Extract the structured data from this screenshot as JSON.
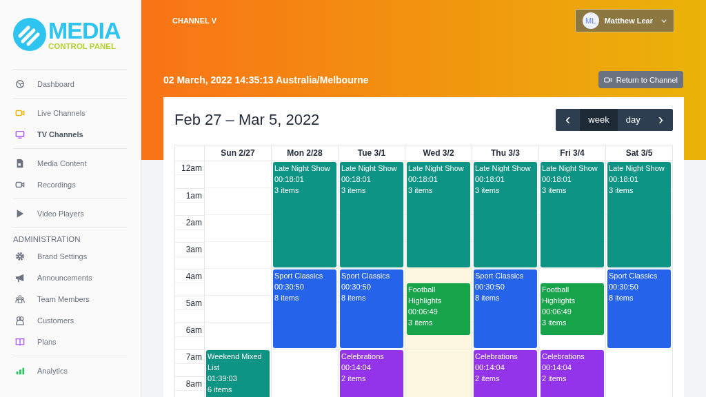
{
  "logo": {
    "title": "MEDIA",
    "subtitle": "CONTROL PANEL"
  },
  "sidebar": {
    "groups": [
      {
        "items": [
          {
            "label": "Dashboard",
            "kind": "dashboard",
            "selected": false
          }
        ]
      },
      {
        "items": [
          {
            "label": "Live Channels",
            "kind": "live",
            "selected": false
          },
          {
            "label": "TV Channels",
            "kind": "tv",
            "selected": true
          }
        ]
      },
      {
        "items": [
          {
            "label": "Media Content",
            "kind": "file",
            "selected": false
          },
          {
            "label": "Recordings",
            "kind": "camera",
            "selected": false
          }
        ]
      },
      {
        "items": [
          {
            "label": "Video Players",
            "kind": "play",
            "selected": false
          }
        ]
      },
      {
        "heading": "ADMINISTRATION",
        "items": [
          {
            "label": "Brand Settings",
            "kind": "gear",
            "selected": false
          },
          {
            "label": "Announcements",
            "kind": "megaphone",
            "selected": false
          },
          {
            "label": "Team Members",
            "kind": "team",
            "selected": false
          },
          {
            "label": "Customers",
            "kind": "users",
            "selected": false
          },
          {
            "label": "Plans",
            "kind": "book",
            "selected": false
          }
        ]
      },
      {
        "items": [
          {
            "label": "Analytics",
            "kind": "chart",
            "selected": false
          }
        ]
      }
    ]
  },
  "header": {
    "channel": "CHANNEL V",
    "user": {
      "initials": "ML",
      "name": "Matthew Lear"
    }
  },
  "datetime": "02 March, 2022 14:35:13 Australia/Melbourne",
  "return_button": "Return to Channel",
  "calendar": {
    "title": "Feb 27 – Mar 5, 2022",
    "toolbar": {
      "prev": "‹",
      "next": "›",
      "views": [
        {
          "label": "week",
          "selected": true
        },
        {
          "label": "day",
          "selected": false
        }
      ]
    },
    "times": [
      "12am",
      "1am",
      "2am",
      "3am",
      "4am",
      "5am",
      "6am",
      "7am",
      "8am"
    ],
    "days": [
      {
        "label": "Sun 2/27",
        "today": false,
        "events": [
          {
            "title": "Weekend Mixed List",
            "duration": "01:39:03",
            "count": "6 items",
            "kind": "day",
            "color": "#0e9484"
          }
        ]
      },
      {
        "label": "Mon 2/28",
        "today": false,
        "events": [
          {
            "title": "Late Night Show",
            "duration": "00:18:01",
            "count": "3 items",
            "kind": "night",
            "color": "#0e9484"
          },
          {
            "title": "Sport Classics",
            "duration": "00:30:50",
            "count": "8 items",
            "kind": "early",
            "color": "#2563eb"
          }
        ]
      },
      {
        "label": "Tue 3/1",
        "today": false,
        "events": [
          {
            "title": "Late Night Show",
            "duration": "00:18:01",
            "count": "3 items",
            "kind": "night",
            "color": "#0e9484"
          },
          {
            "title": "Sport Classics",
            "duration": "00:30:50",
            "count": "8 items",
            "kind": "early",
            "color": "#2563eb"
          },
          {
            "title": "Celebrations",
            "duration": "00:14:04",
            "count": "2 items",
            "kind": "day",
            "color": "#9333ea"
          }
        ]
      },
      {
        "label": "Wed 3/2",
        "today": true,
        "events": [
          {
            "title": "Late Night Show",
            "duration": "00:18:01",
            "count": "3 items",
            "kind": "night",
            "color": "#0e9484"
          },
          {
            "title": "Football Highlights",
            "duration": "00:06:49",
            "count": "3 items",
            "kind": "dawn",
            "color": "#16a34a"
          }
        ]
      },
      {
        "label": "Thu 3/3",
        "today": false,
        "events": [
          {
            "title": "Late Night Show",
            "duration": "00:18:01",
            "count": "3 items",
            "kind": "night",
            "color": "#0e9484"
          },
          {
            "title": "Sport Classics",
            "duration": "00:30:50",
            "count": "8 items",
            "kind": "early",
            "color": "#2563eb"
          },
          {
            "title": "Celebrations",
            "duration": "00:14:04",
            "count": "2 items",
            "kind": "day",
            "color": "#9333ea"
          }
        ]
      },
      {
        "label": "Fri 3/4",
        "today": false,
        "events": [
          {
            "title": "Late Night Show",
            "duration": "00:18:01",
            "count": "3 items",
            "kind": "night",
            "color": "#0e9484"
          },
          {
            "title": "Football Highlights",
            "duration": "00:06:49",
            "count": "3 items",
            "kind": "dawn",
            "color": "#16a34a"
          },
          {
            "title": "Celebrations",
            "duration": "00:14:04",
            "count": "2 items",
            "kind": "day",
            "color": "#9333ea"
          }
        ]
      },
      {
        "label": "Sat 3/5",
        "today": false,
        "events": [
          {
            "title": "Late Night Show",
            "duration": "00:18:01",
            "count": "3 items",
            "kind": "night",
            "color": "#0e9484"
          },
          {
            "title": "Sport Classics",
            "duration": "00:30:50",
            "count": "8 items",
            "kind": "early",
            "color": "#2563eb"
          }
        ]
      }
    ]
  }
}
